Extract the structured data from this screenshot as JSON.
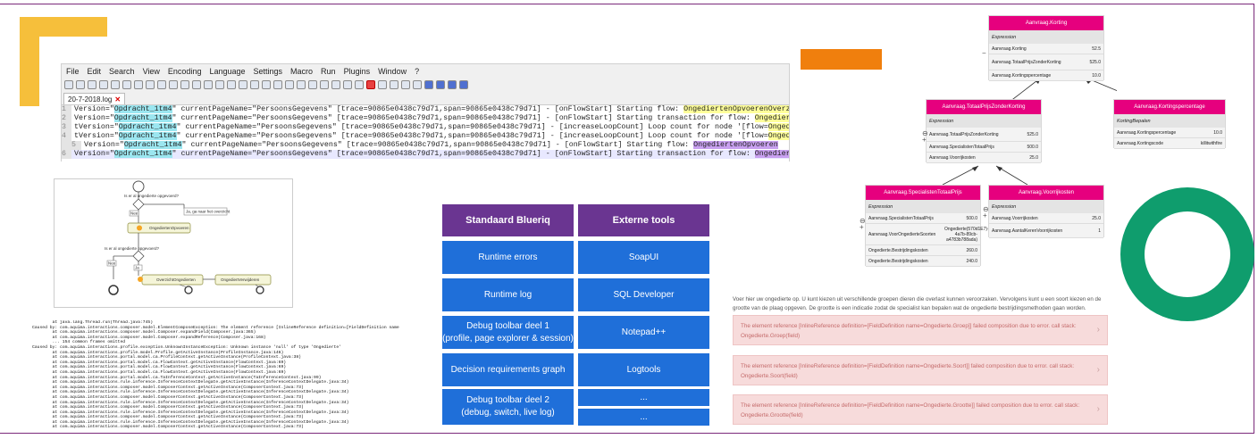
{
  "npp": {
    "menu": [
      "File",
      "Edit",
      "Search",
      "View",
      "Encoding",
      "Language",
      "Settings",
      "Macro",
      "Run",
      "Plugins",
      "Window",
      "?"
    ],
    "tab_label": "20-7-2018.log",
    "tab_close": "✕",
    "lines": [
      {
        "num": "1",
        "pre": "Version=\"",
        "hl1": "Opdracht_1tm4",
        "mid": "\" currentPageName=\"PersoonsGegevens\" [trace=90865e0438c79d71,span=90865e0438c79d71] - [onFlowStart] Starting flow: ",
        "hl2": "OngediertenOpvoerenOverzicht",
        "tail": ""
      },
      {
        "num": "2",
        "pre": "Version=\"",
        "hl1": "Opdracht_1tm4",
        "mid": "\" currentPageName=\"PersoonsGegevens\" [trace=90865e0438c79d71,span=90865e0438c79d71] - [onFlowStart] Starting transaction for flow: ",
        "hl2": "OngediertenOpvoerenOverzicht",
        "tail": ""
      },
      {
        "num": "3",
        "pre": "tVersion=\"",
        "hl1": "Opdracht_1tm4",
        "mid": "\" currentPageName=\"PersoonsGegevens\" [trace=90865e0438c79d71,span=90865e0438c79d71] - [increaseLoopCount] Loop count for node '[flow=",
        "hl2": "OngediertenOpvoerenOverzicht",
        "tail": ""
      },
      {
        "num": "4",
        "pre": "tVersion=\"",
        "hl1": "Opdracht_1tm4",
        "mid": "\" currentPageName=\"PersoonsGegevens\" [trace=90865e0438c79d71,span=90865e0438c79d71] - [increaseLoopCount] Loop count for node '[flow=",
        "hl2": "OngediertenOpvoerenOverzicht",
        "tail": ""
      },
      {
        "num": "5",
        "pre": "Version=\"",
        "hl1": "Opdracht_1tm4",
        "mid": "\" currentPageName=\"PersoonsGegevens\" [trace=90865e0438c79d71,span=90865e0438c79d71] - [onFlowStart] Starting flow: ",
        "hl2": "OngediertenOpvoeren",
        "tail": ""
      },
      {
        "num": "6",
        "pre": "Version=\"",
        "hl1": "Opdracht_1tm4",
        "mid": "\" currentPageName=\"PersoonsGegevens\" [trace=90865e0438c79d71,span=90865e0438c79d71] - [onFlowStart] Starting transaction for flow: ",
        "hl2": "OngediertenOpvoeren",
        "tail": ""
      }
    ]
  },
  "flow": {
    "q1": "Is er al ongedierte opgevoerd?",
    "nee": "Nee",
    "ja": "Ja, ga naar het overzicht",
    "task1": "OngediertenOpvoeren",
    "q2": "Is er al ongedierte opgevoerd?",
    "ja2": "Ja",
    "nee2": "Nee",
    "task2": "OverzichtOngedierten",
    "task3": "OngediertVerwijderen"
  },
  "stack": [
    "        at java.lang.Thread.run(Thread.java:745)",
    "Caused by: com.aquima.interactions.composer.model.ElementComposeException: The element reference [InlineReference definition=[FieldDefinition name",
    "        at com.aquima.interactions.composer.model.Composer.expandField(Composer.java:365)",
    "        at com.aquima.interactions.composer.model.Composer.expandReference(Composer.java:168)",
    "        ... 154 common frames omitted",
    "Caused by: com.aquima.interactions.profile.exception.UnknownInstanceException: Unknown instance 'null' of type 'Ongedierte'",
    "        at com.aquima.interactions.profile.model.Profile.getActiveInstance(ProfileInstance.java:146)",
    "        at com.aquima.interactions.portal.model.ca.ProfileContext.getActiveInstance(ProfileContext.java:38)",
    "        at com.aquima.interactions.portal.model.ca.FlowContext.getActiveInstance(FlowContext.java:69)",
    "        at com.aquima.interactions.portal.model.ca.FlowContext.getActiveInstance(FlowContext.java:69)",
    "        at com.aquima.interactions.portal.model.ca.FlowContext.getActiveInstance(FlowContext.java:69)",
    "        at com.aquima.interactions.portal.model.ca.TaInferenceContext.getActiveInstance(TaInferenceContext.java:99)",
    "        at com.aquima.interactions.rule.inference.InferenceContextDelegate.getActiveInstance(InferenceContextDelegate.java:34)",
    "        at com.aquima.interactions.composer.model.ComposerContext.getActiveInstance(ComposerContext.java:73)",
    "        at com.aquima.interactions.rule.inference.InferenceContextDelegate.getActiveInstance(InferenceContextDelegate.java:34)",
    "        at com.aquima.interactions.composer.model.ComposerContext.getActiveInstance(ComposerContext.java:73)",
    "        at com.aquima.interactions.rule.inference.InferenceContextDelegate.getActiveInstance(InferenceContextDelegate.java:34)",
    "        at com.aquima.interactions.composer.model.ComposerContext.getActiveInstance(ComposerContext.java:73)",
    "        at com.aquima.interactions.rule.inference.InferenceContextDelegate.getActiveInstance(InferenceContextDelegate.java:34)",
    "        at com.aquima.interactions.composer.model.ComposerContext.getActiveInstance(ComposerContext.java:73)",
    "        at com.aquima.interactions.rule.inference.InferenceContextDelegate.getActiveInstance(InferenceContextDelegate.java:34)",
    "        at com.aquima.interactions.composer.model.ComposerContext.getActiveInstance(ComposerContext.java:73)"
  ],
  "tools": {
    "col1_header": "Standaard Blueriq",
    "col2_header": "Externe tools",
    "col1": [
      "Runtime errors",
      "Runtime log",
      "Debug toolbar deel 1\n(profile, page explorer & session)",
      "Decision requirements graph",
      "Debug toolbar deel 2\n(debug, switch, live log)"
    ],
    "col2": [
      "SoapUI",
      "SQL Developer",
      "Notepad++",
      "Logtools",
      "...",
      "..."
    ]
  },
  "drg": {
    "expression": "Expression",
    "top": {
      "title": "Aanvraag.Korting",
      "rows": [
        [
          "Aanvraag.Korting",
          "52.5"
        ],
        [
          "Aanvraag.TotaalPrijsZonderKorting",
          "525.0"
        ],
        [
          "Aanvraag.Kortingspercentage",
          "10.0"
        ]
      ]
    },
    "mid_left": {
      "title": "Aanvraag.TotaalPrijsZonderKorting",
      "rows": [
        [
          "Aanvraag.TotaalPrijsZonderKorting",
          "525.0"
        ],
        [
          "Aanvraag.SpecialistenTotaalPrijs",
          "500.0"
        ],
        [
          "Aanvraag.Voorrijkosten",
          "25.0"
        ]
      ]
    },
    "mid_right": {
      "title": "Aanvraag.Kortingspercentage",
      "sub": "KortingBepalen",
      "rows": [
        [
          "Aanvraag.Kortingspercentage",
          "10.0"
        ],
        [
          "Aanvraag.Kortingscode",
          "killitwithfire"
        ]
      ]
    },
    "bot_left": {
      "title": "Aanvraag.SpecialistenTotaalPrijs",
      "rows": [
        [
          "Aanvraag.SpecialistenTotaalPrijs",
          "500.0"
        ],
        [
          "Aanvraag.VoorOngedierteSoorten",
          "Ongedierte(570d1E7)-7302-4a7b-89cb-a4783b788ada)"
        ],
        [
          "Ongedierte.Bestrijdingskosten",
          "260.0"
        ],
        [
          "Ongedierte.Bestrijdingskosten",
          "240.0"
        ]
      ]
    },
    "bot_right": {
      "title": "Aanvraag.Voorrijkosten",
      "rows": [
        [
          "Aanvraag.Voorrijkosten",
          "25.0"
        ],
        [
          "Aanvraag.AantalKerenVoorrijkosten",
          "1"
        ]
      ]
    }
  },
  "intro": "Voer hier uw ongedierte op. U kunt kiezen uit verschillende groepen dieren die overlast kunnen veroorzaken. Vervolgens kunt u een soort kiezen en de grootte van de plaag opgeven. De grootte is een indicatie zodat de specialist kan bepalen wat de ongedierte bestrijdingsmethoden gaan worden.",
  "errors": [
    "The element reference [InlineReference definition=[FieldDefinition name=Ongedierte.Groep]] failed composition due to error. call stack: Ongedierte.Groep(field)",
    "The element reference [InlineReference definition=[FieldDefinition name=Ongedierte.Soort]] failed composition due to error. call stack: Ongedierte.Soort(field)",
    "The element reference [InlineReference definition=[FieldDefinition name=Ongedierte.Grootte]] failed composition due to error. call stack: Ongedierte.Grootte(field)"
  ],
  "chevron": "›",
  "colors": {
    "purple": "#6a3591",
    "blue": "#1f6fd9",
    "magenta": "#e6007e",
    "green": "#0f9d6d",
    "orange": "#f07f0d",
    "yellow": "#f6bf3b"
  }
}
